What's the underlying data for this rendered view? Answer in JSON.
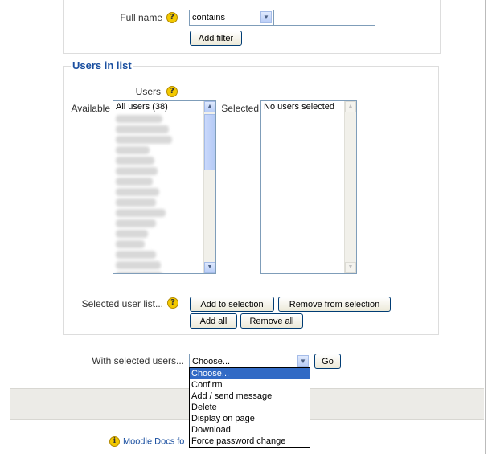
{
  "filter": {
    "label": "Full name",
    "help": "?",
    "operator": "contains",
    "value": "",
    "add_button": "Add filter"
  },
  "users_section": {
    "legend": "Users in list",
    "users_label": "Users",
    "available_label": "Available",
    "available_first": "All users (38)",
    "selected_label": "Selected",
    "selected_first": "No users selected"
  },
  "selected_list": {
    "label": "Selected user list...",
    "add_to_selection": "Add to selection",
    "remove_from_selection": "Remove from selection",
    "add_all": "Add all",
    "remove_all": "Remove all"
  },
  "bulk": {
    "label": "With selected users...",
    "current": "Choose...",
    "go": "Go",
    "options": [
      "Choose...",
      "Confirm",
      "Add / send message",
      "Delete",
      "Display on page",
      "Download",
      "Force password change"
    ]
  },
  "footer": {
    "docs_link": "Moodle Docs fo"
  },
  "icons": {
    "help": "help-icon",
    "info": "info-icon",
    "dropdown_arrow": "chevron-down-icon"
  }
}
